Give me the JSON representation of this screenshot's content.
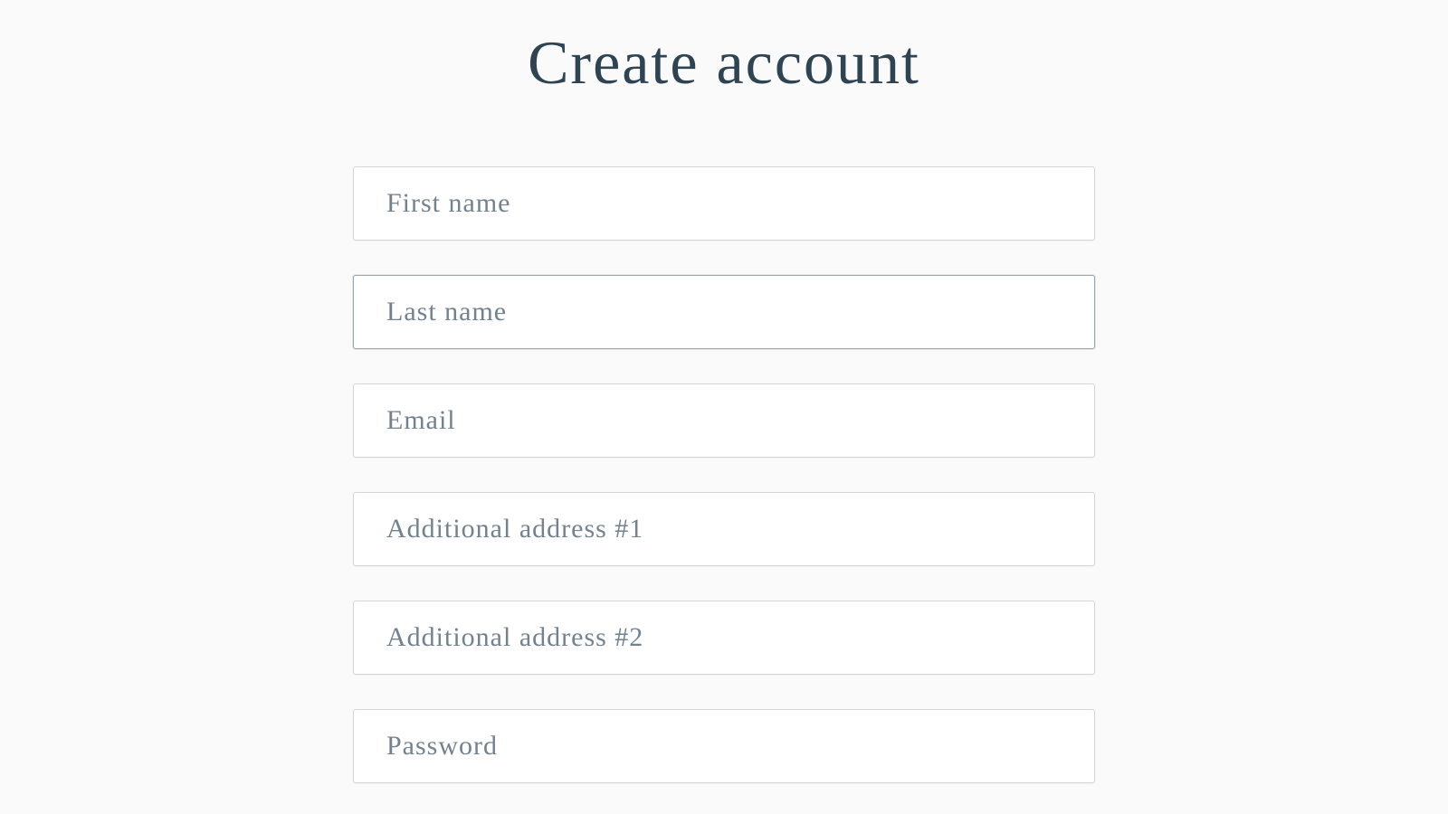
{
  "title": "Create account",
  "fields": {
    "first_name": {
      "placeholder": "First name",
      "value": ""
    },
    "last_name": {
      "placeholder": "Last name",
      "value": ""
    },
    "email": {
      "placeholder": "Email",
      "value": ""
    },
    "address1": {
      "placeholder": "Additional address #1",
      "value": ""
    },
    "address2": {
      "placeholder": "Additional address #2",
      "value": ""
    },
    "password": {
      "placeholder": "Password",
      "value": ""
    }
  }
}
